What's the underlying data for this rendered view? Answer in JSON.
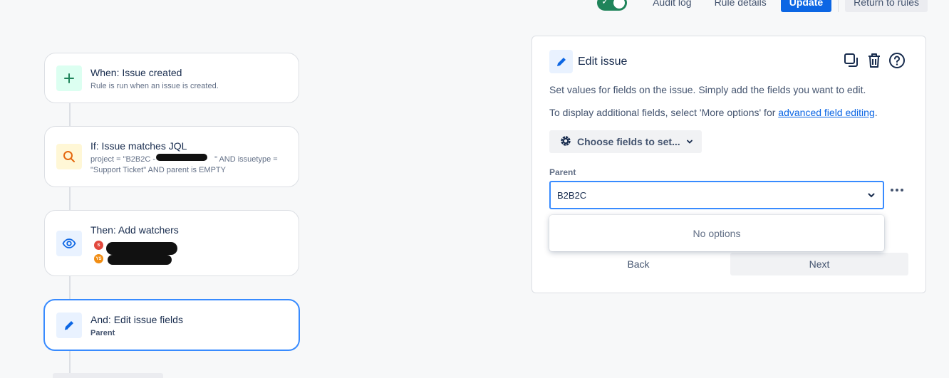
{
  "topbar": {
    "audit_log": "Audit log",
    "rule_details": "Rule details",
    "update": "Update",
    "return_to_rules": "Return to rules",
    "toggle_on": true
  },
  "flow": {
    "trigger": {
      "title": "When: Issue created",
      "subtitle": "Rule is run when an issue is created.",
      "icon": "plus-icon"
    },
    "condition": {
      "title": "If: Issue matches JQL",
      "jql_prefix": "project = \"B2B2C - ",
      "jql_suffix": "\" AND issuetype =",
      "jql_line2": "\"Support Ticket\" AND parent is EMPTY",
      "icon": "search-icon"
    },
    "action1": {
      "title": "Then: Add watchers",
      "avatars": [
        {
          "initials": "S",
          "color": "#e2483d"
        },
        {
          "initials": "YS",
          "color": "#f18d13"
        }
      ],
      "icon": "eye-icon"
    },
    "action2": {
      "title": "And: Edit issue fields",
      "subtitle": "Parent",
      "icon": "pencil-icon"
    }
  },
  "panel": {
    "title": "Edit issue",
    "description": "Set values for fields on the issue. Simply add the fields you want to edit.",
    "additional_prefix": "To display additional fields, select 'More options' for ",
    "additional_link": "advanced field editing",
    "additional_suffix": ".",
    "choose_fields": "Choose fields to set...",
    "parent_label": "Parent",
    "parent_value": "B2B2C",
    "no_options": "No options",
    "back": "Back",
    "next": "Next"
  },
  "colors": {
    "primary": "#0c66e4",
    "toggle": "#1f845a",
    "selected_border": "#388bff"
  }
}
